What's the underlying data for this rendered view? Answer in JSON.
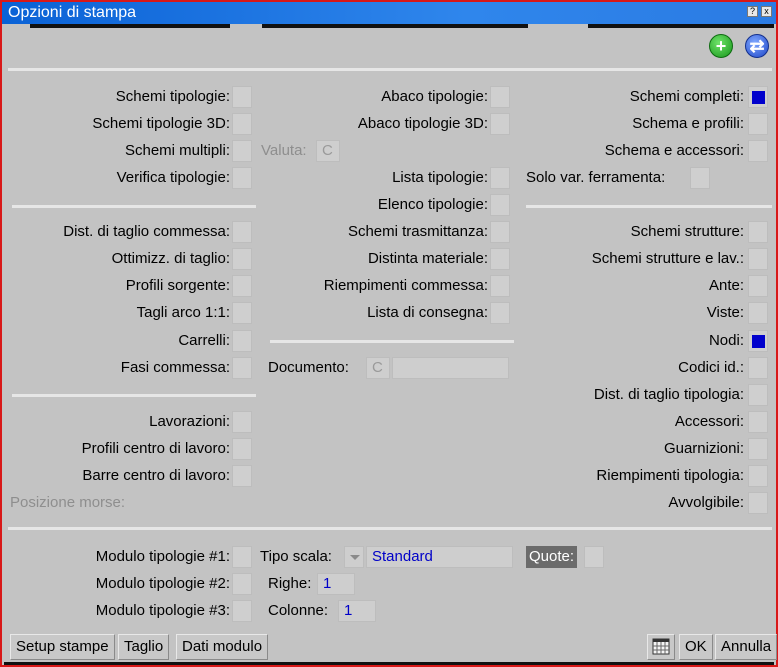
{
  "window": {
    "title": "Opzioni di stampa",
    "help_glyph": "?",
    "close_glyph": "x"
  },
  "toolbar": {
    "add_glyph": "+",
    "swap_glyph": "⇄"
  },
  "col1": {
    "schemi_tipologie": "Schemi tipologie:",
    "schemi_tipologie_3d": "Schemi tipologie 3D:",
    "schemi_multipli": "Schemi multipli:",
    "verifica_tipologie": "Verifica tipologie:",
    "dist_taglio_commessa": "Dist. di taglio commessa:",
    "ottimizz_taglio": "Ottimizz. di taglio:",
    "profili_sorgente": "Profili sorgente:",
    "tagli_arco": "Tagli arco 1:1:",
    "carrelli": "Carrelli:",
    "fasi_commessa": "Fasi commessa:",
    "lavorazioni": "Lavorazioni:",
    "profili_centro": "Profili centro di lavoro:",
    "barre_centro": "Barre centro di lavoro:",
    "posizione_morse": "Posizione morse:"
  },
  "col2": {
    "abaco_tipologie": "Abaco tipologie:",
    "abaco_tipologie_3d": "Abaco tipologie 3D:",
    "valuta_label": "Valuta:",
    "valuta_value": "C",
    "lista_tipologie": "Lista tipologie:",
    "elenco_tipologie": "Elenco tipologie:",
    "schemi_trasmittanza": "Schemi trasmittanza:",
    "distinta_materiale": "Distinta materiale:",
    "riempimenti_commessa": "Riempimenti commessa:",
    "lista_consegna": "Lista di consegna:",
    "documento_label": "Documento:",
    "documento_value": "C"
  },
  "col3": {
    "schemi_completi": "Schemi completi:",
    "schema_profili": "Schema e profili:",
    "schema_accessori": "Schema e accessori:",
    "solo_var_ferramenta": "Solo var. ferramenta:",
    "schemi_strutture": "Schemi strutture:",
    "schemi_strutture_lav": "Schemi strutture e lav.:",
    "ante": "Ante:",
    "viste": "Viste:",
    "nodi": "Nodi:",
    "codici_id": "Codici id.:",
    "dist_taglio_tipologia": "Dist. di taglio tipologia:",
    "accessori": "Accessori:",
    "guarnizioni": "Guarnizioni:",
    "riempimenti_tipologia": "Riempimenti tipologia:",
    "avvolgibile": "Avvolgibile:"
  },
  "checked": {
    "schemi_completi": true,
    "nodi": true
  },
  "moduli": {
    "m1": "Modulo tipologie #1:",
    "m2": "Modulo tipologie #2:",
    "m3": "Modulo tipologie #3:",
    "tipo_scala_label": "Tipo scala:",
    "tipo_scala_value": "Standard",
    "righe_label": "Righe:",
    "righe_value": "1",
    "colonne_label": "Colonne:",
    "colonne_value": "1",
    "quote_label": "Quote:"
  },
  "footer": {
    "setup_stampe": "Setup stampe",
    "taglio": "Taglio",
    "dati_modulo": "Dati modulo",
    "ok": "OK",
    "annulla": "Annulla"
  }
}
